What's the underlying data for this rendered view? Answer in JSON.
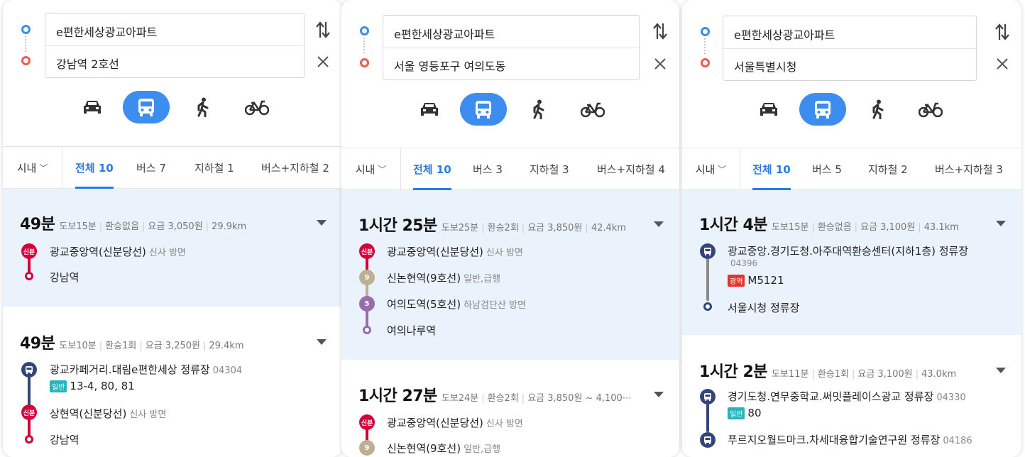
{
  "colors": {
    "accent": "#3d8cf0",
    "start": "#3b8ee8",
    "end": "#ef5b4c",
    "shinbundang": "#d4003b",
    "line9": "#bdb092",
    "line5": "#996cac",
    "bus": "#33457a",
    "highlight": "#eaf2fc"
  },
  "panels": [
    {
      "from": "e편한세상광교아파트",
      "to": "강남역 2호선",
      "modes": [
        "car-icon",
        "bus-icon",
        "walk-icon",
        "bike-icon"
      ],
      "scope": "시내",
      "tabs": [
        "전체 10",
        "버스 7",
        "지하철 1",
        "버스+지하철 2"
      ],
      "routes": [
        {
          "duration": "49분",
          "walk": "도보15분",
          "transfer": "환승없음",
          "fare": "요금 3,050원",
          "distance": "29.9km",
          "steps": [
            {
              "badge": "신분",
              "name": "광교중앙역(신분당선)",
              "dir": "신사 방면"
            },
            {
              "name": "강남역"
            }
          ]
        },
        {
          "duration": "49분",
          "walk": "도보10분",
          "transfer": "환승1회",
          "fare": "요금 3,250원",
          "distance": "29.4km",
          "steps": [
            {
              "name": "광교카페거리.대림e편한세상 정류장",
              "code": "04304",
              "bus_tag": "일반",
              "bus_no": "13-4, 80, 81"
            },
            {
              "badge": "신분",
              "name": "상현역(신분당선)",
              "dir": "신사 방면"
            },
            {
              "name": "강남역"
            }
          ]
        }
      ]
    },
    {
      "from": "e편한세상광교아파트",
      "to": "서울 영등포구 여의도동",
      "modes": [
        "car-icon",
        "bus-icon",
        "walk-icon",
        "bike-icon"
      ],
      "scope": "시내",
      "tabs": [
        "전체 10",
        "버스 3",
        "지하철 3",
        "버스+지하철 4"
      ],
      "routes": [
        {
          "duration": "1시간 25분",
          "walk": "도보25분",
          "transfer": "환승2회",
          "fare": "요금 3,850원",
          "distance": "42.4km",
          "steps": [
            {
              "badge": "신분",
              "name": "광교중앙역(신분당선)",
              "dir": "신사 방면"
            },
            {
              "badge": "9",
              "name": "신논현역(9호선)",
              "dir": "일반,급행"
            },
            {
              "badge": "5",
              "name": "여의도역(5호선)",
              "dir": "하남검단산 방면"
            },
            {
              "name": "여의나루역"
            }
          ]
        },
        {
          "duration": "1시간 27분",
          "walk": "도보24분",
          "transfer": "환승2회",
          "fare": "요금 3,850원 ~ 4,100⋯",
          "steps": [
            {
              "badge": "신분",
              "name": "광교중앙역(신분당선)",
              "dir": "신사 방면"
            },
            {
              "badge": "9",
              "name": "신논현역(9호선)",
              "dir": "일반,급행"
            }
          ]
        }
      ]
    },
    {
      "from": "e편한세상광교아파트",
      "to": "서울특별시청",
      "modes": [
        "car-icon",
        "bus-icon",
        "walk-icon",
        "bike-icon"
      ],
      "scope": "시내",
      "tabs": [
        "전체 10",
        "버스 5",
        "지하철 2",
        "버스+지하철 3"
      ],
      "routes": [
        {
          "duration": "1시간 4분",
          "walk": "도보15분",
          "transfer": "환승없음",
          "fare": "요금 3,100원",
          "distance": "43.1km",
          "steps": [
            {
              "name": "광교중앙.경기도청.아주대역환승센터(지하1층) 정류장",
              "code": "04396",
              "bus_tag": "광역",
              "bus_no": "M5121"
            },
            {
              "name": "서울시청 정류장"
            }
          ]
        },
        {
          "duration": "1시간 2분",
          "walk": "도보11분",
          "transfer": "환승1회",
          "fare": "요금 3,100원",
          "distance": "43.0km",
          "steps": [
            {
              "name": "경기도청.연무중학교.써밋플레이스광교 정류장",
              "code": "04330",
              "bus_tag": "일반",
              "bus_no": "80"
            },
            {
              "name": "푸르지오월드마크.차세대융합기술연구원 정류장",
              "code": "04186"
            }
          ]
        }
      ]
    }
  ]
}
